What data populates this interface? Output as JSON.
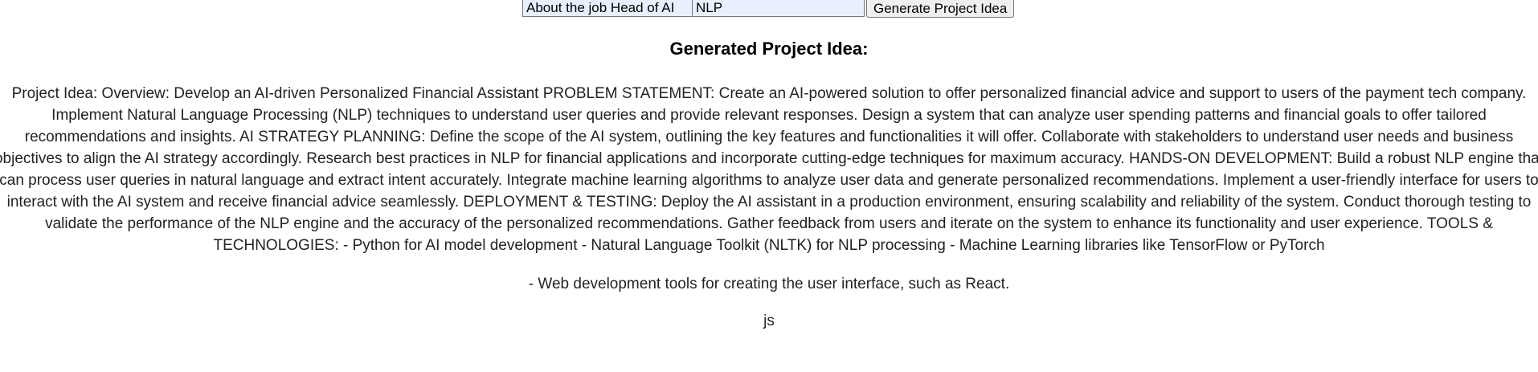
{
  "form": {
    "job_description_value": "About the job Head of AI",
    "keyword_value": "NLP",
    "generate_label": "Generate Project Idea"
  },
  "result": {
    "heading": "Generated Project Idea:",
    "text": "Project Idea: Overview: Develop an AI-driven Personalized Financial Assistant PROBLEM STATEMENT: Create an AI-powered solution to offer personalized financial advice and support to users of the payment tech company. Implement Natural Language Processing (NLP) techniques to understand user queries and provide relevant responses. Design a system that can analyze user spending patterns and financial goals to offer tailored recommendations and insights. AI STRATEGY PLANNING: Define the scope of the AI system, outlining the key features and functionalities it will offer. Collaborate with stakeholders to understand user needs and business objectives to align the AI strategy accordingly. Research best practices in NLP for financial applications and incorporate cutting-edge techniques for maximum accuracy. HANDS-ON DEVELOPMENT: Build a robust NLP engine that can process user queries in natural language and extract intent accurately. Integrate machine learning algorithms to analyze user data and generate personalized recommendations. Implement a user-friendly interface for users to interact with the AI system and receive financial advice seamlessly. DEPLOYMENT & TESTING: Deploy the AI assistant in a production environment, ensuring scalability and reliability of the system. Conduct thorough testing to validate the performance of the NLP engine and the accuracy of the personalized recommendations. Gather feedback from users and iterate on the system to enhance its functionality and user experience. TOOLS & TECHNOLOGIES: - Python for AI model development - Natural Language Toolkit (NLTK) for NLP processing - Machine Learning libraries like TensorFlow or PyTorch",
    "extra_line": "- Web development tools for creating the user interface, such as React.",
    "tail_line": "js"
  },
  "colors": {
    "input_autofill_bg": "#e8f0fe",
    "button_bg": "#efefef",
    "text": "#222222"
  }
}
